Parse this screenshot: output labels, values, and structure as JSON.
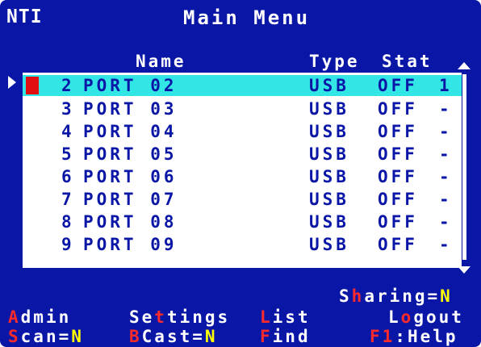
{
  "header": {
    "logo": "NTI",
    "title": "Main Menu"
  },
  "columns": {
    "name": "Name",
    "type": "Type",
    "stat": "Stat"
  },
  "ports": [
    {
      "num": "2",
      "name": "PORT 02",
      "type": "USB",
      "stat": "OFF",
      "id": "1",
      "selected": true
    },
    {
      "num": "3",
      "name": "PORT 03",
      "type": "USB",
      "stat": "OFF",
      "id": "-"
    },
    {
      "num": "4",
      "name": "PORT 04",
      "type": "USB",
      "stat": "OFF",
      "id": "-"
    },
    {
      "num": "5",
      "name": "PORT 05",
      "type": "USB",
      "stat": "OFF",
      "id": "-"
    },
    {
      "num": "6",
      "name": "PORT 06",
      "type": "USB",
      "stat": "OFF",
      "id": "-"
    },
    {
      "num": "7",
      "name": "PORT 07",
      "type": "USB",
      "stat": "OFF",
      "id": "-"
    },
    {
      "num": "8",
      "name": "PORT 08",
      "type": "USB",
      "stat": "OFF",
      "id": "-"
    },
    {
      "num": "9",
      "name": "PORT 09",
      "type": "USB",
      "stat": "OFF",
      "id": "-"
    }
  ],
  "footer": {
    "sharing": {
      "pre": "S",
      "hot": "h",
      "post": "aring=",
      "value": "N"
    },
    "admin": {
      "hot": "A",
      "rest": "dmin"
    },
    "settings": {
      "pre": "Se",
      "hot": "t",
      "rest": "tings"
    },
    "list": {
      "hot": "L",
      "rest": "ist"
    },
    "logout": {
      "pre": "L",
      "hot": "o",
      "rest": "gout"
    },
    "scan": {
      "hot": "S",
      "rest": "can=",
      "value": "N"
    },
    "bcast": {
      "hot": "B",
      "rest": "Cast=",
      "value": "N"
    },
    "find": {
      "hot": "F",
      "rest": "ind"
    },
    "help": {
      "hot": "F1",
      "rest": ":Help"
    }
  },
  "colors": {
    "background": "#0a16a6",
    "selection": "#33e6e6",
    "hotkey": "#ff2a2a",
    "value": "#ffff00",
    "text": "#ffffff"
  }
}
